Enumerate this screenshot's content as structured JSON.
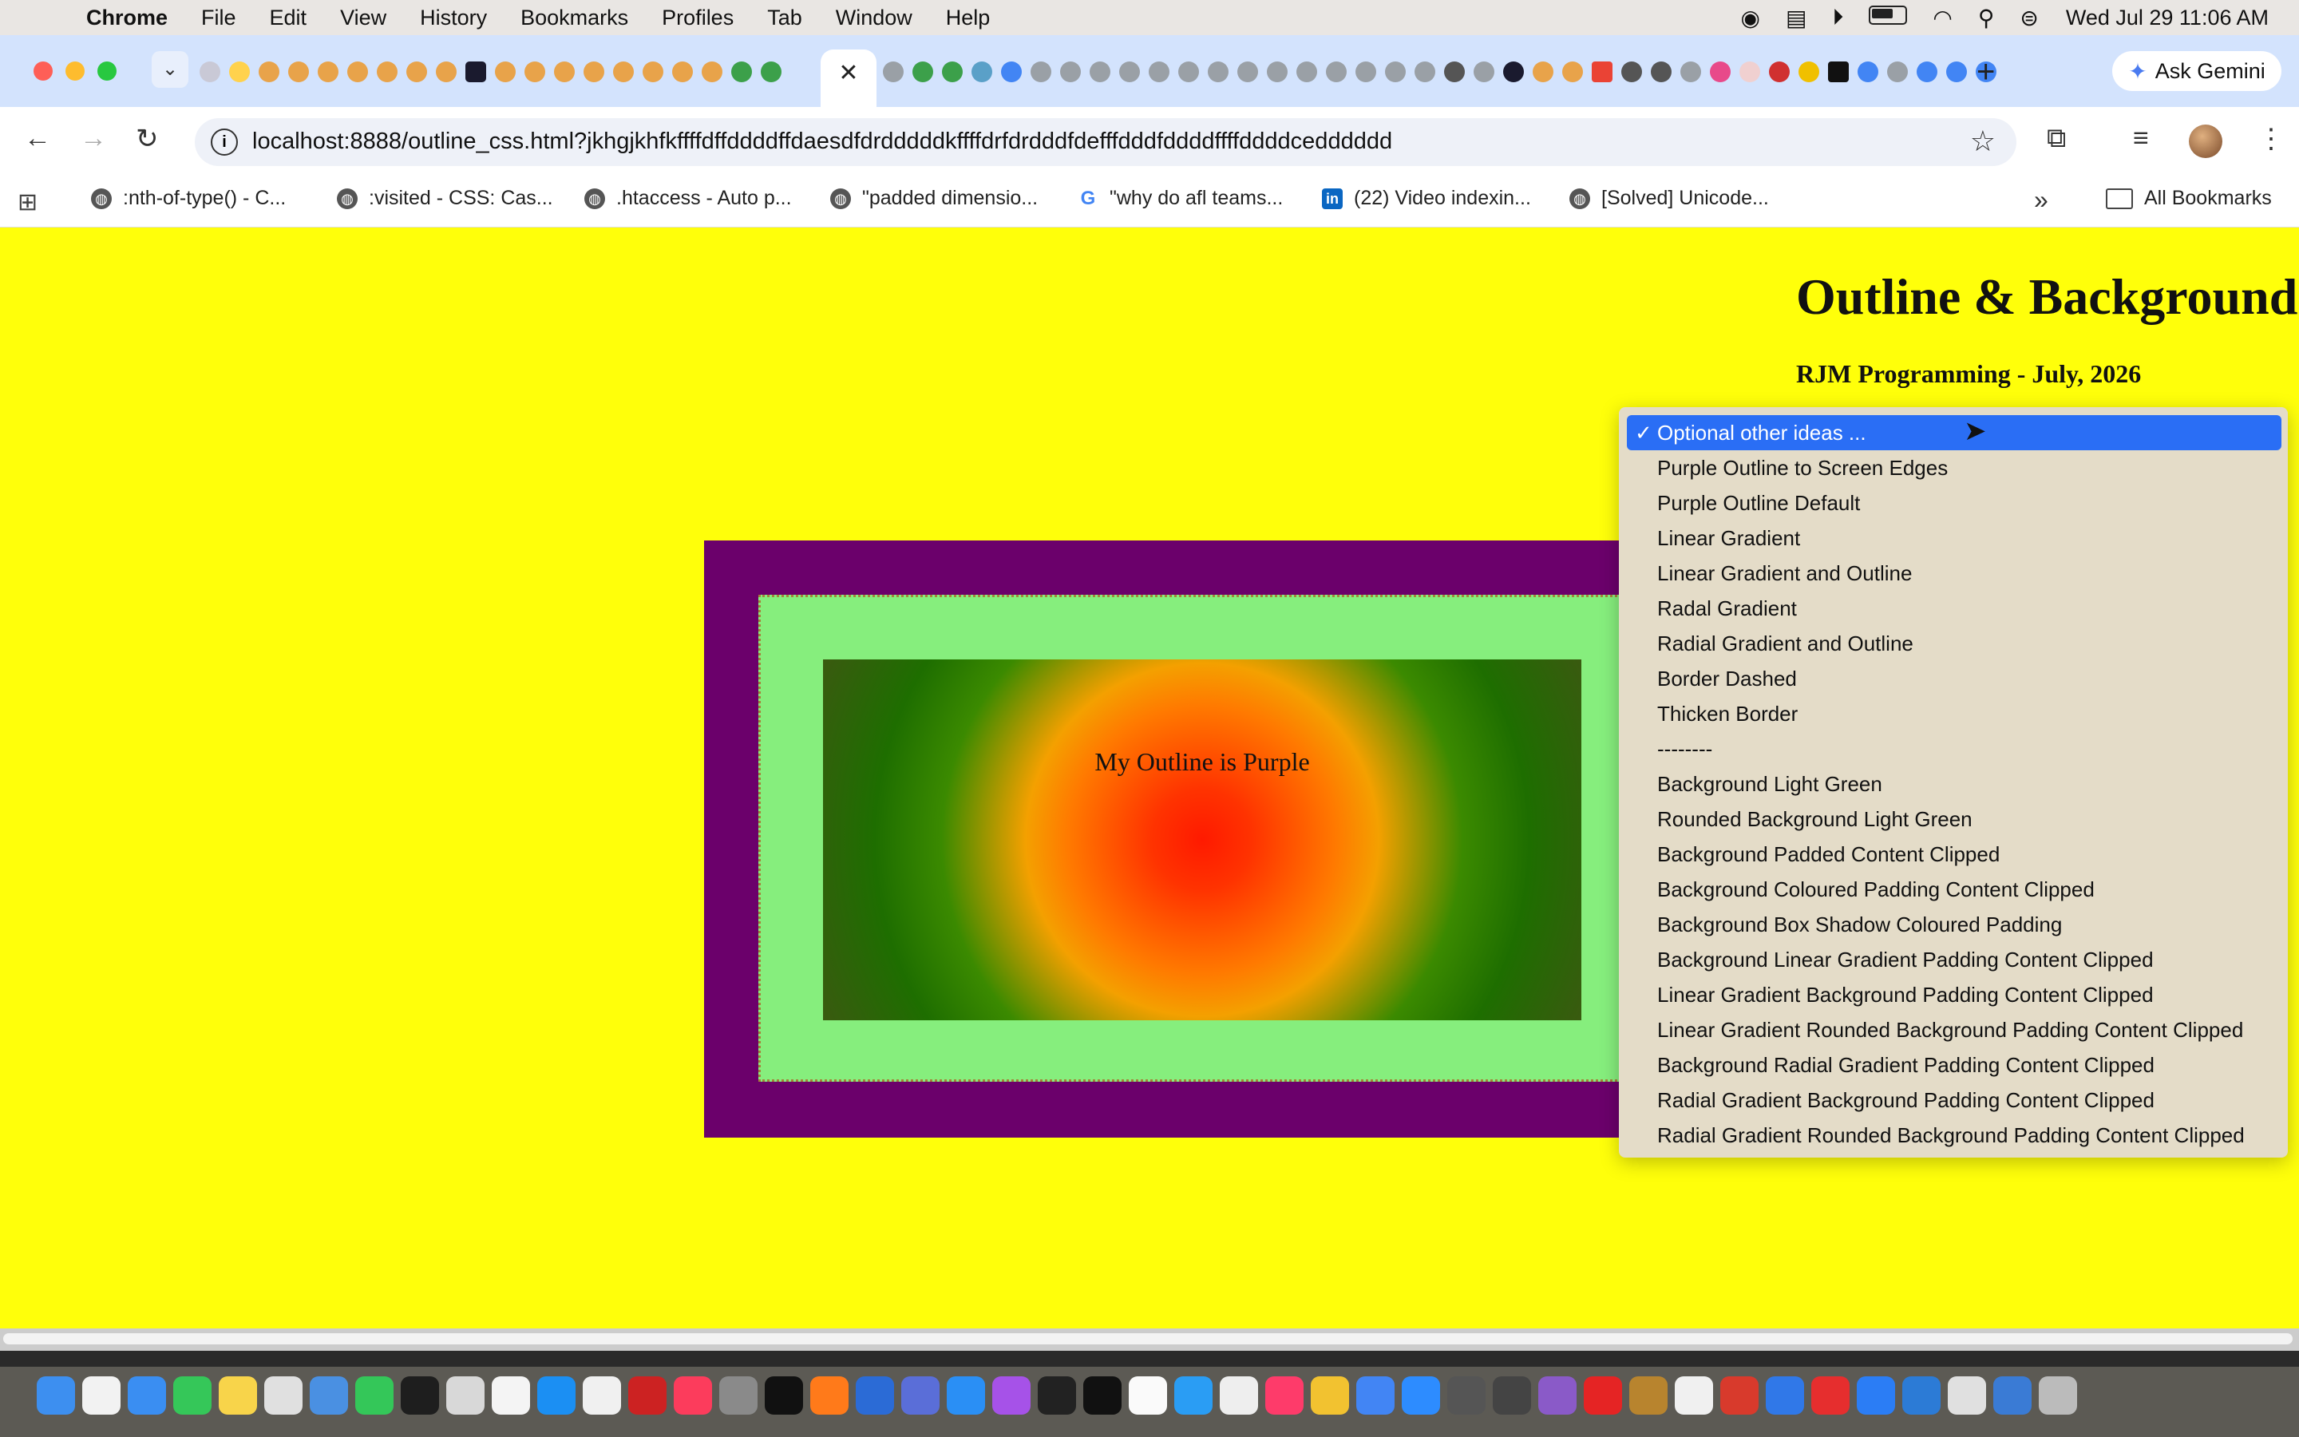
{
  "menubar": {
    "app": "Chrome",
    "items": [
      "File",
      "Edit",
      "View",
      "History",
      "Bookmarks",
      "Profiles",
      "Tab",
      "Window",
      "Help"
    ],
    "clock": "Wed Jul 29  11:06 AM"
  },
  "tabs": {
    "active_close": "✕",
    "new_tab": "+",
    "ask_gemini": "Ask Gemini"
  },
  "toolbar": {
    "url": "localhost:8888/outline_css.html?jkhgjkhfkffffdffddddffdaesdfdrdddddkffffdrfdrdddfdefffdddfddddffffddddcedddddd"
  },
  "bookmarks": [
    {
      "label": ":nth-of-type() - C...",
      "icon": "globe-icon"
    },
    {
      "label": ":visited - CSS: Cas...",
      "icon": "globe-icon"
    },
    {
      "label": ".htaccess - Auto p...",
      "icon": "globe-icon"
    },
    {
      "label": "\"padded dimensio...",
      "icon": "globe-icon"
    },
    {
      "label": "\"why do afl teams...",
      "icon": "google-icon"
    },
    {
      "label": "(22) Video indexin...",
      "icon": "linkedin-icon"
    },
    {
      "label": "[Solved] Unicode...",
      "icon": "globe-icon"
    }
  ],
  "bookmarks_all": "All Bookmarks",
  "page": {
    "title": "Outline & Background",
    "subtitle": "RJM Programming - July, 2026",
    "box_text": "My Outline is Purple"
  },
  "dropdown": {
    "selected": "Optional other ideas ...",
    "options": [
      "Purple Outline to Screen Edges",
      "Purple Outline Default",
      "Linear Gradient",
      "Linear Gradient and Outline",
      "Radal Gradient",
      "Radial Gradient and Outline",
      "Border Dashed",
      "Thicken Border",
      "--------",
      "Background Light Green",
      "Rounded Background Light Green",
      "Background Padded Content Clipped",
      "Background Coloured Padding Content Clipped",
      "Background Box Shadow Coloured Padding",
      "Background Linear Gradient Padding Content Clipped",
      "Linear Gradient Background Padding Content Clipped",
      "Linear Gradient Rounded Background Padding Content Clipped",
      "Background Radial Gradient Padding Content Clipped",
      "Radial Gradient Background Padding Content Clipped",
      "Radial Gradient Rounded Background Padding Content Clipped"
    ]
  },
  "colors": {
    "page_background": "#ffff0a",
    "outline": "#6b006b",
    "light_green": "#86ee7d",
    "select_highlight": "#2a6ef5"
  }
}
